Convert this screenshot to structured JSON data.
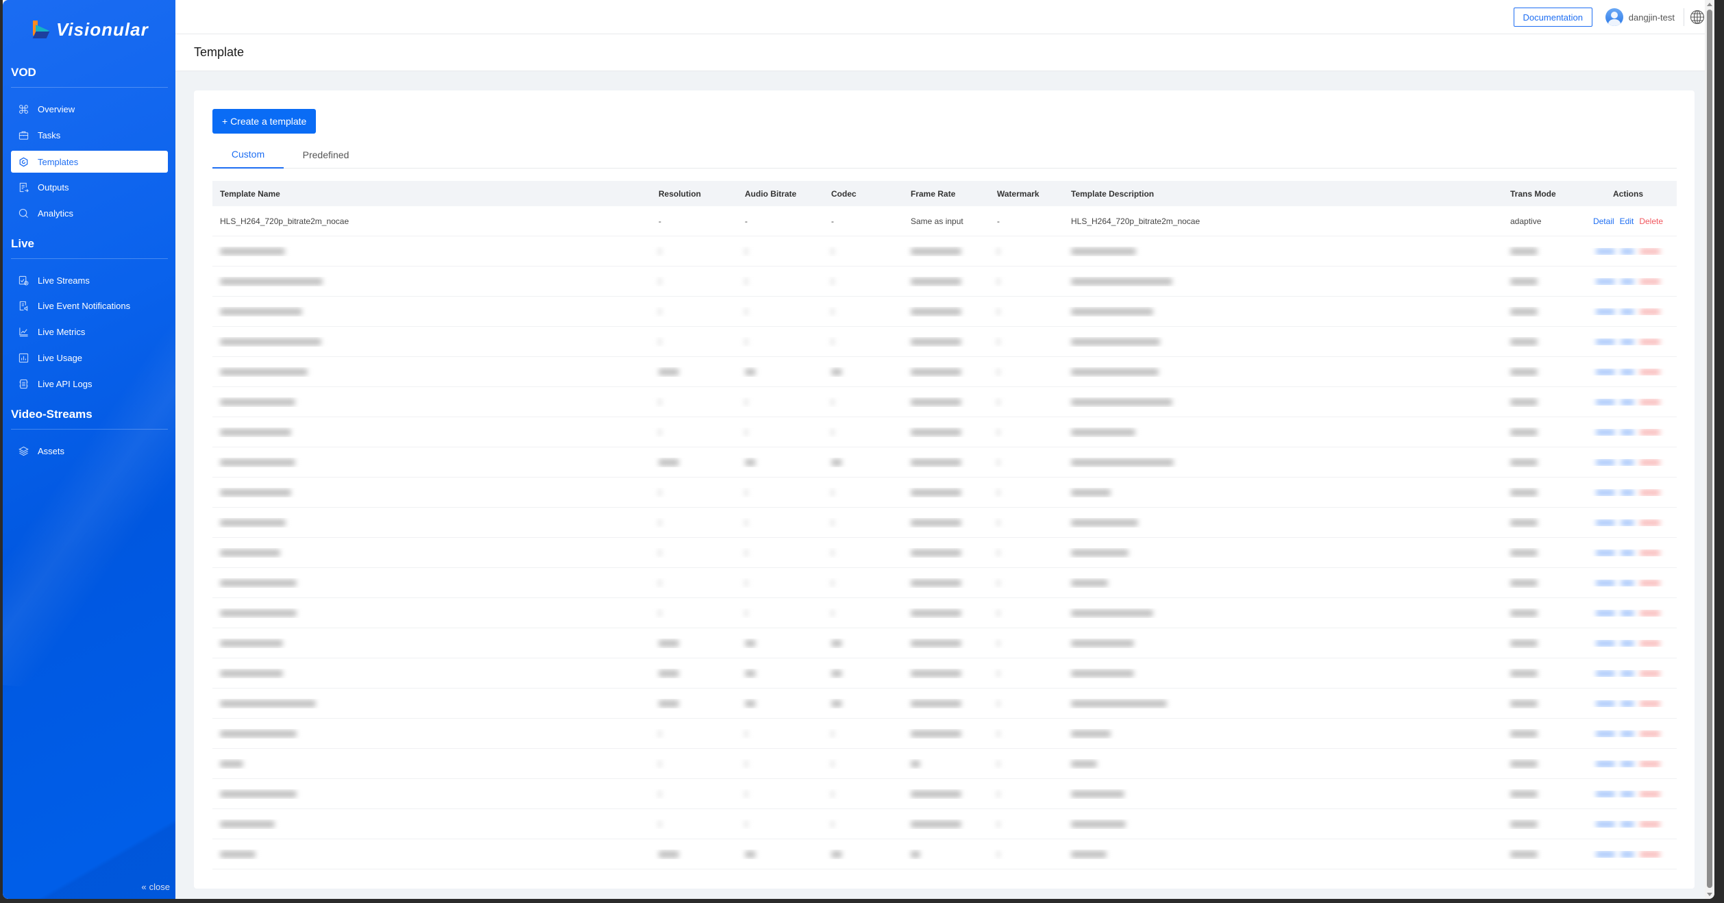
{
  "brand": {
    "name": "Visionular"
  },
  "sidebar": {
    "sections": [
      {
        "title": "VOD",
        "items": [
          {
            "label": "Overview",
            "icon": "command-icon",
            "active": false
          },
          {
            "label": "Tasks",
            "icon": "briefcase-icon",
            "active": false
          },
          {
            "label": "Templates",
            "icon": "hexagon-icon",
            "active": true
          },
          {
            "label": "Outputs",
            "icon": "document-export-icon",
            "active": false
          },
          {
            "label": "Analytics",
            "icon": "search-analytics-icon",
            "active": false
          }
        ]
      },
      {
        "title": "Live",
        "items": [
          {
            "label": "Live Streams",
            "icon": "stream-clock-icon",
            "active": false
          },
          {
            "label": "Live Event Notifications",
            "icon": "notification-doc-icon",
            "active": false
          },
          {
            "label": "Live Metrics",
            "icon": "line-chart-icon",
            "active": false
          },
          {
            "label": "Live Usage",
            "icon": "bar-chart-icon",
            "active": false
          },
          {
            "label": "Live API Logs",
            "icon": "api-log-icon",
            "active": false
          }
        ]
      },
      {
        "title": "Video-Streams",
        "items": [
          {
            "label": "Assets",
            "icon": "layers-icon",
            "active": false
          }
        ]
      }
    ],
    "close_label": "close"
  },
  "topbar": {
    "documentation_label": "Documentation",
    "username": "dangjin-test",
    "language_icon": "globe-icon"
  },
  "page": {
    "title": "Template",
    "create_button_label": "+ Create a template",
    "tabs": [
      {
        "label": "Custom",
        "active": true
      },
      {
        "label": "Predefined",
        "active": false
      }
    ]
  },
  "table": {
    "columns": [
      "Template Name",
      "Resolution",
      "Audio Bitrate",
      "Codec",
      "Frame Rate",
      "Watermark",
      "Template Description",
      "Trans Mode",
      "Actions"
    ],
    "actions": {
      "detail": "Detail",
      "edit": "Edit",
      "delete": "Delete"
    },
    "rows": [
      {
        "name": "HLS_H264_720p_bitrate2m_nocae",
        "resolution": "-",
        "audio_bitrate": "-",
        "codec": "-",
        "frame_rate": "Same as input",
        "watermark": "-",
        "description": "HLS_H264_720p_bitrate2m_nocae",
        "trans_mode": "adaptive"
      }
    ],
    "redacted_row_count": 21
  },
  "colors": {
    "accent": "#1e6ef2",
    "primary_button": "#0a6cf5",
    "sidebar": "#0a62ec",
    "delete": "#f0565d",
    "page_bg": "#f0f3f6"
  }
}
